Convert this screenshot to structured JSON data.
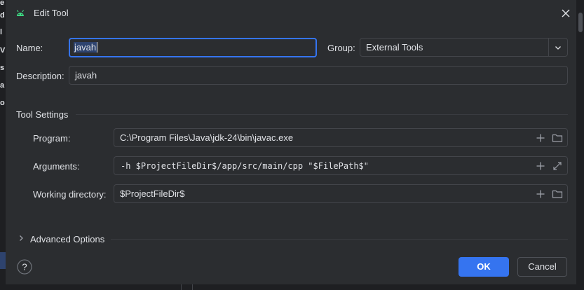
{
  "background": {
    "left_letters": [
      "e",
      "d",
      "l",
      "V",
      "s",
      "a",
      "o"
    ]
  },
  "dialog": {
    "title": "Edit Tool",
    "name_label": "Name:",
    "name_value": "javah",
    "group_label": "Group:",
    "group_value": "External Tools",
    "description_label": "Description:",
    "description_value": "javah"
  },
  "tool_settings": {
    "title": "Tool Settings",
    "program_label": "Program:",
    "program_value": "C:\\Program Files\\Java\\jdk-24\\bin\\javac.exe",
    "arguments_label": "Arguments:",
    "arguments_value": "-h $ProjectFileDir$/app/src/main/cpp \"$FilePath$\"",
    "working_dir_label": "Working directory:",
    "working_dir_value": "$ProjectFileDir$"
  },
  "advanced": {
    "label": "Advanced Options"
  },
  "footer": {
    "ok_label": "OK",
    "cancel_label": "Cancel",
    "help_symbol": "?"
  },
  "colors": {
    "accent": "#3574f0",
    "background": "#2b2d30",
    "border": "#43454a",
    "text": "#dfe1e5"
  }
}
